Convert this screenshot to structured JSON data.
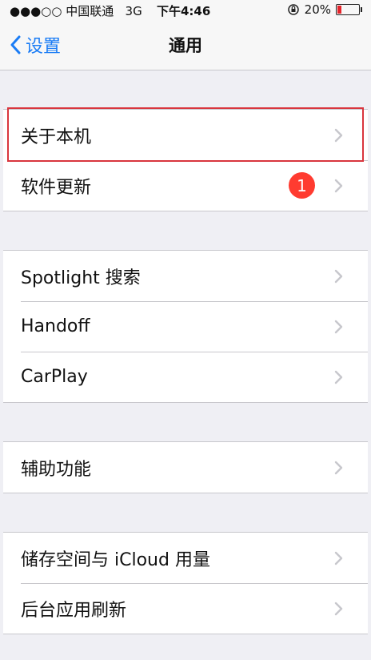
{
  "status_bar": {
    "carrier": "●●●○○ 中国联通",
    "network": "3G",
    "time": "下午4:46",
    "battery_text": "20%",
    "battery_level": 0.2,
    "battery_color": "#e5242b"
  },
  "nav": {
    "back_label": "设置",
    "title": "通用"
  },
  "groups": [
    {
      "rows": [
        {
          "label": "关于本机"
        },
        {
          "label": "软件更新",
          "badge": "1"
        }
      ]
    },
    {
      "rows": [
        {
          "label": "Spotlight 搜索"
        },
        {
          "label": "Handoff"
        },
        {
          "label": "CarPlay"
        }
      ]
    },
    {
      "rows": [
        {
          "label": "辅助功能"
        }
      ]
    },
    {
      "rows": [
        {
          "label": "储存空间与 iCloud 用量"
        },
        {
          "label": "后台应用刷新"
        }
      ]
    }
  ],
  "colors": {
    "accent": "#1a7cf5",
    "badge": "#ff3b30",
    "highlight": "#d9363e"
  }
}
